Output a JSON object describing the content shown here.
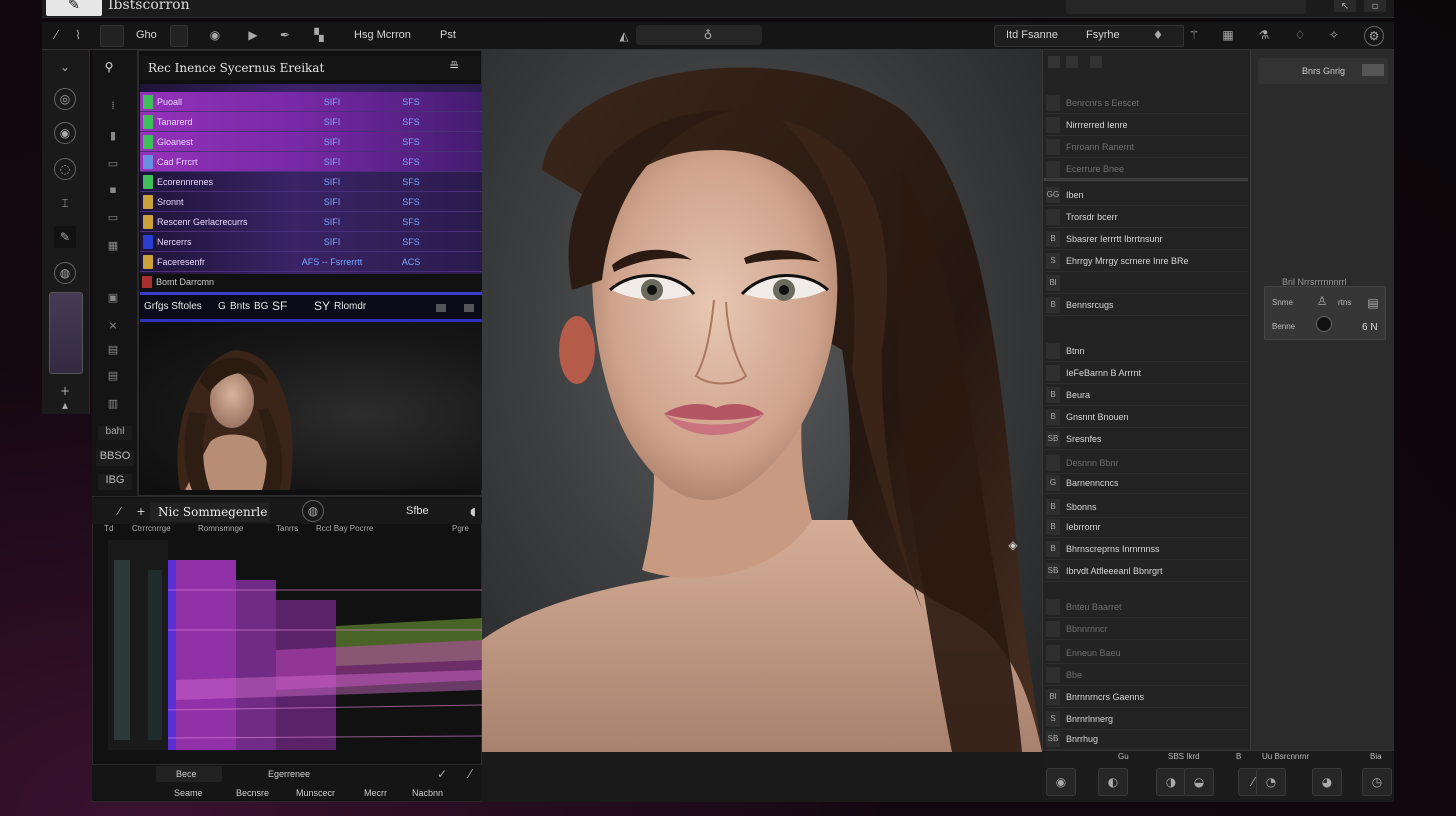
{
  "app": {
    "title": "Ibstscorron"
  },
  "toolbar": {
    "left_label_1": "Gho",
    "center_label_1": "Hsg Mcrron",
    "center_label_2": "Pst",
    "right_label_1": "Itd Fsanne",
    "right_label_2": "Fsyrhe"
  },
  "layers_panel": {
    "title": "Rec Inence Sycernus Ereikat",
    "rows": [
      {
        "name": "Puoall",
        "v1": "SIFI",
        "v2": "SFS",
        "chip": "#3fbf5a",
        "highlight": true
      },
      {
        "name": "Tanarerd",
        "v1": "SIFI",
        "v2": "SFS",
        "chip": "#3fbf5a",
        "highlight": true
      },
      {
        "name": "Gloanest",
        "v1": "SIFI",
        "v2": "SFS",
        "chip": "#3fbf5a",
        "highlight": true
      },
      {
        "name": "Cad Frrcrt",
        "v1": "SIFI",
        "v2": "SFS",
        "chip": "#6a8fe0",
        "highlight": true
      },
      {
        "name": "Ecorennrenes",
        "v1": "SIFI",
        "v2": "SFS",
        "chip": "#3fbf5a",
        "highlight": false
      },
      {
        "name": "Sronnt",
        "v1": "SIFI",
        "v2": "SFS",
        "chip": "#c9a23a",
        "highlight": false
      },
      {
        "name": "Rescenr Gerlacrecurrs",
        "v1": "SIFI",
        "v2": "SFS",
        "chip": "#c9a23a",
        "highlight": false
      },
      {
        "name": "Nercerrs",
        "v1": "SIFI",
        "v2": "SFS",
        "chip": "#2a3ed0",
        "highlight": false
      },
      {
        "name": "Faceresenfr",
        "v1": "AFS  -- Fsrrerrtt",
        "v2": "ACS",
        "chip": "#c9a23a",
        "highlight": false
      }
    ],
    "footer": "Bomt Darrcmn"
  },
  "blue_bar": {
    "t1": "Grfgs Sftoles",
    "t2": "G",
    "t3": "Bnts",
    "t4": "BG",
    "t5": "SF",
    "t6": "SY",
    "t7": "Rlomdr"
  },
  "left_strip": {
    "num_a": "bahl",
    "num_b": "BBSO",
    "num_c": "IBG"
  },
  "curve_panel": {
    "title": "Nic Sommegenrle",
    "stat": "Sfbe",
    "cols": [
      "Td",
      "Ctrrrcnrrge",
      "Romnsmnge",
      "Tanrrs",
      "Rccl Bay Pocrre",
      "Pgre"
    ],
    "bottom_row_1": [
      "Bece",
      "Egerrenee"
    ],
    "bottom_row_2": [
      "Seame",
      "Becnsre",
      "Munscecr",
      "Mecrr",
      "Nacbnn"
    ]
  },
  "right_panel": {
    "rows": [
      {
        "text": "Benrcnrs  s  Eescet",
        "dim": true,
        "chip": ""
      },
      {
        "text": "Nirrrerred Ienre",
        "dim": false,
        "chip": ""
      },
      {
        "text": "Fnroann  Ranernt",
        "dim": true,
        "chip": ""
      },
      {
        "text": "Ecerrure  Bnee",
        "dim": true,
        "chip": ""
      },
      {
        "text": "Iben",
        "dim": false,
        "chip": "GG"
      },
      {
        "text": "Trorsdr bcerr",
        "dim": false,
        "chip": ""
      },
      {
        "text": "Sbasrer Ierrrtt Ibrrtnsunr",
        "dim": false,
        "chip": "B"
      },
      {
        "text": "Ehrrgy Mrrgy scrnere  Inre  BRe",
        "dim": false,
        "chip": "S"
      },
      {
        "text": "",
        "dim": false,
        "chip": "Bl"
      },
      {
        "text": "Bennsrcugs",
        "dim": false,
        "chip": "B"
      },
      {
        "text": "Btnn",
        "dim": false,
        "chip": ""
      },
      {
        "text": "IeFeBarnn B Arrrnt",
        "dim": false,
        "chip": ""
      },
      {
        "text": "Beura",
        "dim": false,
        "chip": "B"
      },
      {
        "text": "Gnsnnt Bnouen",
        "dim": false,
        "chip": "B"
      },
      {
        "text": "Sresnfes",
        "dim": false,
        "chip": "SB"
      },
      {
        "text": "Desnnn  Bbnr",
        "dim": true,
        "chip": ""
      },
      {
        "text": "Barnenncncs",
        "dim": false,
        "chip": "G"
      },
      {
        "text": "Sbonns",
        "dim": false,
        "chip": "B"
      },
      {
        "text": "Iebrrornr",
        "dim": false,
        "chip": "B"
      },
      {
        "text": "Bhrnscreprns Inrnrnnss",
        "dim": false,
        "chip": "B"
      },
      {
        "text": "Ibrvdt Atfleeeanl Bbnrgrt",
        "dim": false,
        "chip": "SB"
      },
      {
        "text": "Bnteu   Baarret",
        "dim": true,
        "chip": ""
      },
      {
        "text": "Bbnnrnncr",
        "dim": true,
        "chip": ""
      },
      {
        "text": "Enneun  Baeu",
        "dim": true,
        "chip": ""
      },
      {
        "text": "Bbe",
        "dim": true,
        "chip": ""
      },
      {
        "text": "Bnrnnrncrs Gaenns",
        "dim": false,
        "chip": "Bl"
      },
      {
        "text": "Bnrnrlnnerg",
        "dim": false,
        "chip": "S"
      },
      {
        "text": "Bnrrhug",
        "dim": false,
        "chip": "SB"
      }
    ]
  },
  "far_panel": {
    "top_label": "Bnrs Gnrig",
    "label": "Bril  Nrrsrrrnnnrrl",
    "card_t1": "Snme",
    "card_t2": "Benne",
    "card_t3": "rtns",
    "card_t4": "6 N"
  },
  "bottom_right": {
    "labels": [
      "Gu",
      "SBS  Ikrd",
      "B",
      "Uu  Bsrcnnrnr",
      "Bia"
    ]
  },
  "icons": {
    "accent": "#b23ad6",
    "highlight_blue": "#3a3cd0"
  }
}
